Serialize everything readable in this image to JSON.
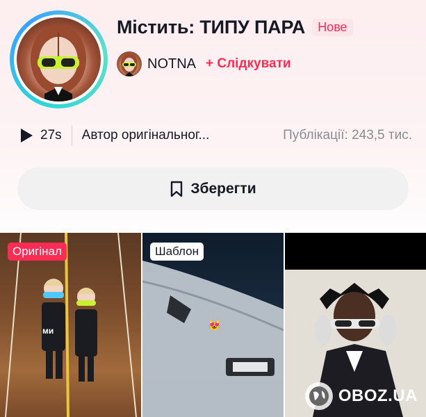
{
  "header": {
    "title": "Містить: ТИПУ ПАРА",
    "badge": "Нове",
    "author": "NOTNA",
    "follow_label": "+ Слідкувати"
  },
  "stats": {
    "duration": "27s",
    "original_author": "Автор оригінальног...",
    "publications": "Публікації: 243,5 тис."
  },
  "save_button": {
    "label": "Зберегти"
  },
  "tiles": [
    {
      "tag": "Оригінал",
      "caption": "ми"
    },
    {
      "tag": "Шаблон"
    },
    {
      "tag": ""
    }
  ],
  "watermark": {
    "text": "OBOZ.UA"
  },
  "colors": {
    "accent": "#fe2c55",
    "ring": "#2fd4d9"
  }
}
